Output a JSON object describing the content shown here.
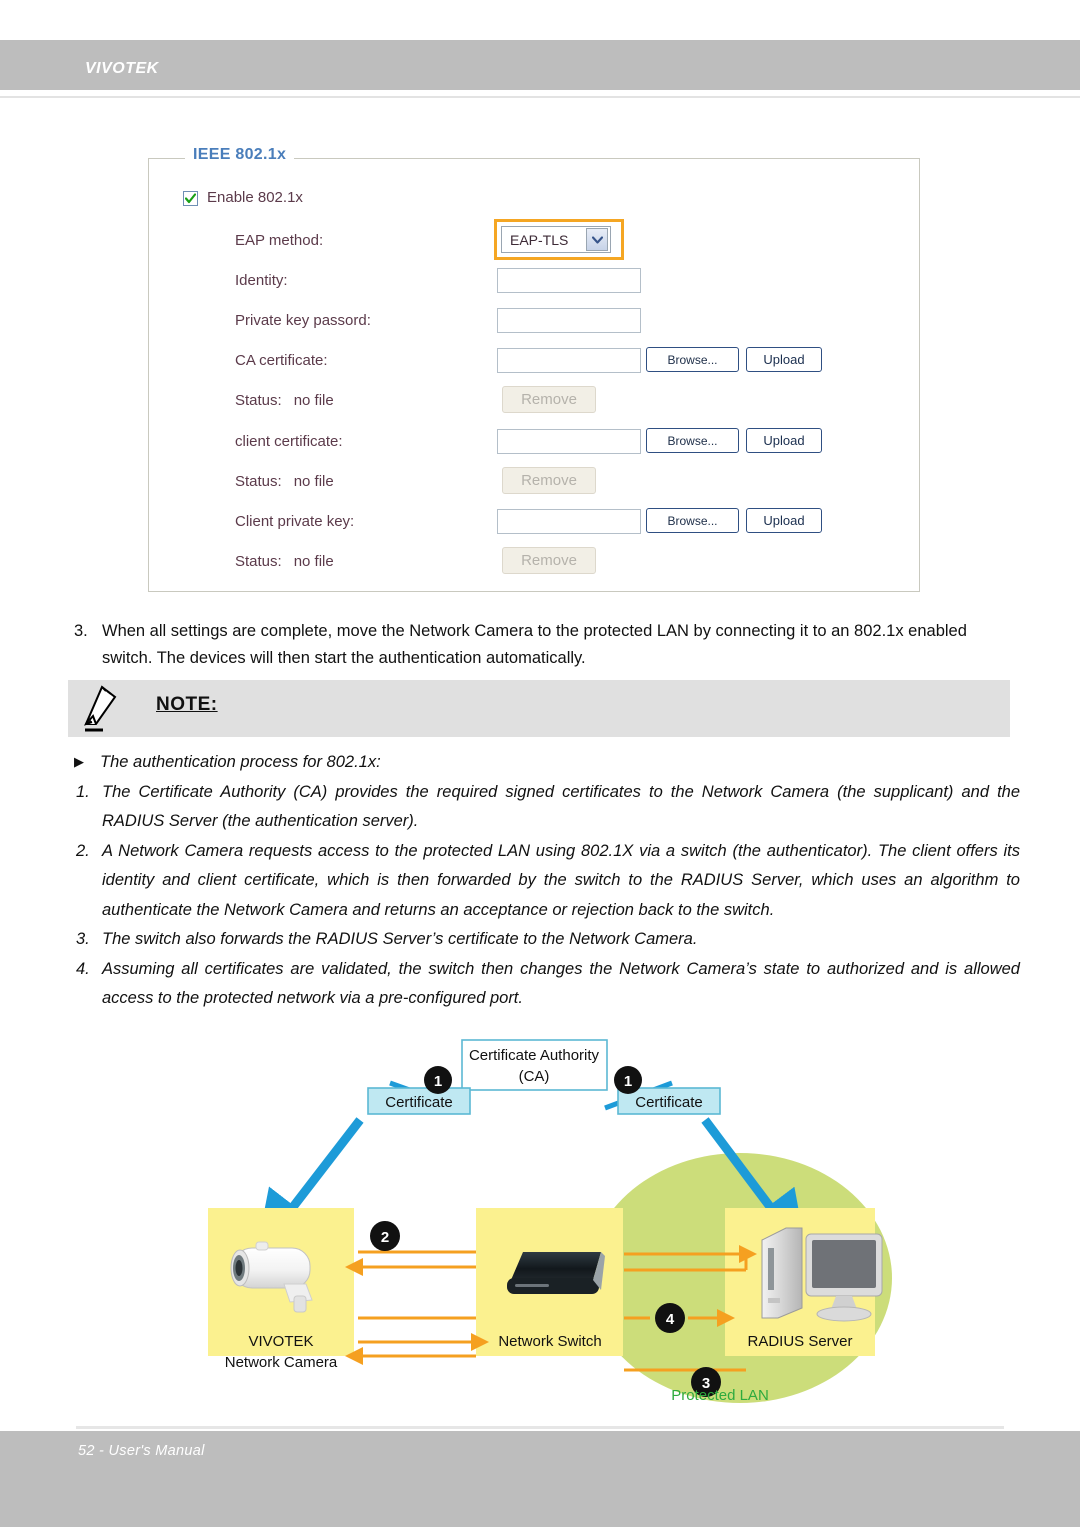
{
  "header": {
    "brand": "VIVOTEK"
  },
  "panel": {
    "legend": "IEEE 802.1x",
    "enable": {
      "label": "Enable 802.1x",
      "checked": true
    },
    "rows": [
      {
        "label": "EAP method:",
        "type": "select",
        "value": "EAP-TLS",
        "highlighted": true
      },
      {
        "label": "Identity:",
        "type": "text",
        "value": ""
      },
      {
        "label": "Private key passord:",
        "type": "text",
        "value": ""
      },
      {
        "label": "CA certificate:",
        "type": "file",
        "value": "",
        "browse": "Browse...",
        "upload": "Upload"
      },
      {
        "label": "Status:",
        "type": "status",
        "value": "no file",
        "remove": "Remove"
      },
      {
        "label": "client certificate:",
        "type": "file",
        "value": "",
        "browse": "Browse...",
        "upload": "Upload"
      },
      {
        "label": "Status:",
        "type": "status",
        "value": "no file",
        "remove": "Remove"
      },
      {
        "label": "Client private key:",
        "type": "file",
        "value": "",
        "browse": "Browse...",
        "upload": "Upload"
      },
      {
        "label": "Status:",
        "type": "status",
        "value": "no file",
        "remove": "Remove"
      }
    ]
  },
  "step3": {
    "number": "3.",
    "text": "When all settings are complete, move the Network Camera to the protected LAN by connecting it to an 802.1x enabled switch. The devices will then start the authentication automatically."
  },
  "note": {
    "title": "NOTE:",
    "intro": "The authentication process for 802.1x:",
    "items": [
      {
        "n": "1.",
        "text": "The Certificate Authority (CA) provides the required signed certificates to the Network Camera (the supplicant) and the RADIUS Server (the authentication server)."
      },
      {
        "n": "2.",
        "text": "A Network Camera requests access to the protected LAN using 802.1X via a switch (the authenticator). The client offers its identity and client certificate, which is then forwarded by the switch to the RADIUS Server, which uses an algorithm to authenticate the Network Camera and returns an acceptance or rejection back to the switch."
      },
      {
        "n": "3.",
        "text": "The switch also forwards the RADIUS Server’s certificate to the Network Camera."
      },
      {
        "n": "4.",
        "text": "Assuming all certificates are validated, the switch then changes the Network Camera’s state to authorized and is allowed access to the protected network via a pre-configured port."
      }
    ]
  },
  "diagram": {
    "ca_title_line1": "Certificate Authority",
    "ca_title_line2": "(CA)",
    "certificate_left": "Certificate",
    "certificate_right": "Certificate",
    "camera_line1": "VIVOTEK",
    "camera_line2": "Network Camera",
    "switch_label": "Network Switch",
    "server_label": "RADIUS Server",
    "lan_label": "Protected LAN",
    "badges": [
      "1",
      "1",
      "2",
      "3",
      "4"
    ],
    "colors": {
      "blue_arrow": "#1d9bd8",
      "orange_arrow": "#f5a020",
      "node_yellow": "#fbf18f",
      "lan_green": "#ccdd7a",
      "cert_fill": "#bfe8f2",
      "cert_border": "#5bb8d4",
      "lan_text": "#2eaa3e"
    }
  },
  "footer": {
    "text": "52 - User's Manual"
  }
}
